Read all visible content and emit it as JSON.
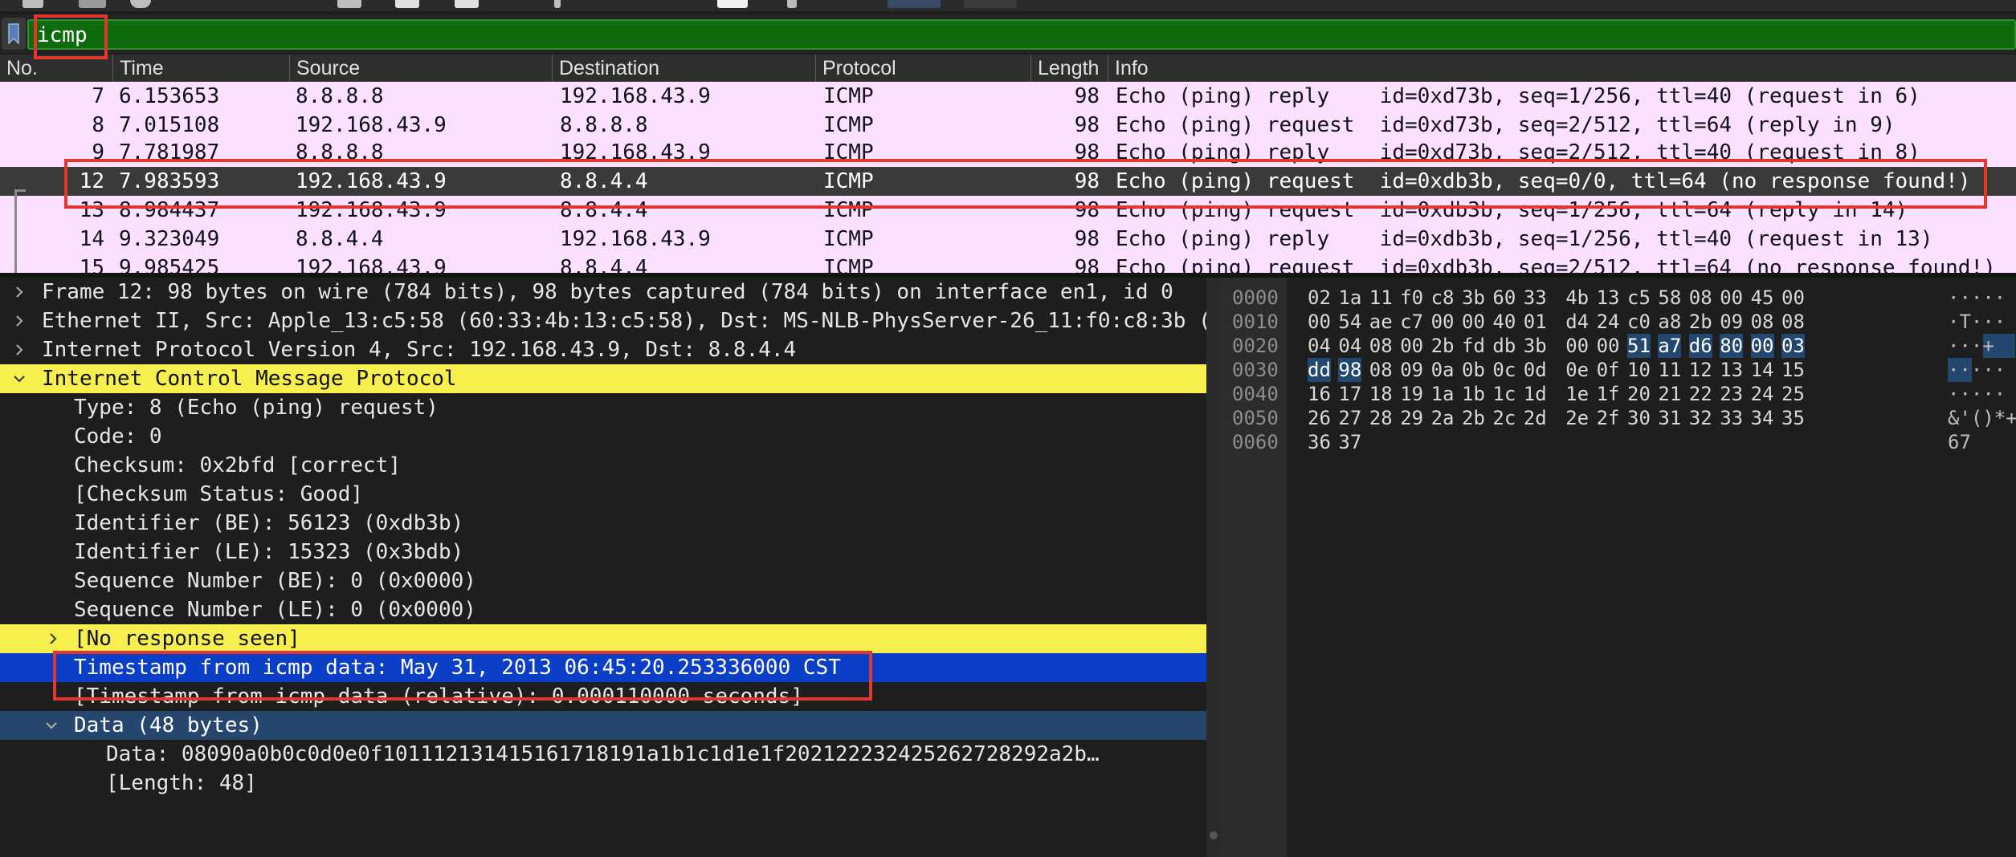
{
  "filter": {
    "value": "icmp"
  },
  "packet_list": {
    "columns": [
      "No.",
      "Time",
      "Source",
      "Destination",
      "Protocol",
      "Length",
      "Info"
    ],
    "rows": [
      {
        "no": "7",
        "time": "6.153653",
        "source": "8.8.8.8",
        "destination": "192.168.43.9",
        "protocol": "ICMP",
        "length": "98",
        "info": "Echo (ping) reply    id=0xd73b, seq=1/256, ttl=40 (request in 6)"
      },
      {
        "no": "8",
        "time": "7.015108",
        "source": "192.168.43.9",
        "destination": "8.8.8.8",
        "protocol": "ICMP",
        "length": "98",
        "info": "Echo (ping) request  id=0xd73b, seq=2/512, ttl=64 (reply in 9)"
      },
      {
        "no": "9",
        "time": "7.781987",
        "source": "8.8.8.8",
        "destination": "192.168.43.9",
        "protocol": "ICMP",
        "length": "98",
        "info": "Echo (ping) reply    id=0xd73b, seq=2/512, ttl=40 (request in 8)"
      },
      {
        "no": "12",
        "time": "7.983593",
        "source": "192.168.43.9",
        "destination": "8.8.4.4",
        "protocol": "ICMP",
        "length": "98",
        "info": "Echo (ping) request  id=0xdb3b, seq=0/0, ttl=64 (no response found!)"
      },
      {
        "no": "13",
        "time": "8.984437",
        "source": "192.168.43.9",
        "destination": "8.8.4.4",
        "protocol": "ICMP",
        "length": "98",
        "info": "Echo (ping) request  id=0xdb3b, seq=1/256, ttl=64 (reply in 14)"
      },
      {
        "no": "14",
        "time": "9.323049",
        "source": "8.8.4.4",
        "destination": "192.168.43.9",
        "protocol": "ICMP",
        "length": "98",
        "info": "Echo (ping) reply    id=0xdb3b, seq=1/256, ttl=40 (request in 13)"
      },
      {
        "no": "15",
        "time": "9.985425",
        "source": "192.168.43.9",
        "destination": "8.8.4.4",
        "protocol": "ICMP",
        "length": "98",
        "info": "Echo (ping) request  id=0xdb3b, seq=2/512, ttl=64 (no response found!)"
      }
    ]
  },
  "details": {
    "lines": [
      "Frame 12: 98 bytes on wire (784 bits), 98 bytes captured (784 bits) on interface en1, id 0",
      "Ethernet II, Src: Apple_13:c5:58 (60:33:4b:13:c5:58), Dst: MS-NLB-PhysServer-26_11:f0:c8:3b (",
      "Internet Protocol Version 4, Src: 192.168.43.9, Dst: 8.8.4.4",
      "Internet Control Message Protocol",
      "Type: 8 (Echo (ping) request)",
      "Code: 0",
      "Checksum: 0x2bfd [correct]",
      "[Checksum Status: Good]",
      "Identifier (BE): 56123 (0xdb3b)",
      "Identifier (LE): 15323 (0x3bdb)",
      "Sequence Number (BE): 0 (0x0000)",
      "Sequence Number (LE): 0 (0x0000)",
      "[No response seen]",
      "Timestamp from icmp data: May 31, 2013 06:45:20.253336000 CST",
      "[Timestamp from icmp data (relative): 0.000110000 seconds]",
      "Data (48 bytes)",
      "Data: 08090a0b0c0d0e0f101112131415161718191a1b1c1d1e1f202122232425262728292a2b…",
      "[Length: 48]"
    ]
  },
  "bytes": {
    "offsets": [
      "0000",
      "0010",
      "0020",
      "0030",
      "0040",
      "0050",
      "0060"
    ],
    "rows": [
      [
        "02",
        "1a",
        "11",
        "f0",
        "c8",
        "3b",
        "60",
        "33",
        "4b",
        "13",
        "c5",
        "58",
        "08",
        "00",
        "45",
        "00"
      ],
      [
        "00",
        "54",
        "ae",
        "c7",
        "00",
        "00",
        "40",
        "01",
        "d4",
        "24",
        "c0",
        "a8",
        "2b",
        "09",
        "08",
        "08"
      ],
      [
        "04",
        "04",
        "08",
        "00",
        "2b",
        "fd",
        "db",
        "3b",
        "00",
        "00",
        "51",
        "a7",
        "d6",
        "80",
        "00",
        "03"
      ],
      [
        "dd",
        "98",
        "08",
        "09",
        "0a",
        "0b",
        "0c",
        "0d",
        "0e",
        "0f",
        "10",
        "11",
        "12",
        "13",
        "14",
        "15"
      ],
      [
        "16",
        "17",
        "18",
        "19",
        "1a",
        "1b",
        "1c",
        "1d",
        "1e",
        "1f",
        "20",
        "21",
        "22",
        "23",
        "24",
        "25"
      ],
      [
        "26",
        "27",
        "28",
        "29",
        "2a",
        "2b",
        "2c",
        "2d",
        "2e",
        "2f",
        "30",
        "31",
        "32",
        "33",
        "34",
        "35"
      ],
      [
        "36",
        "37"
      ]
    ],
    "ascii": [
      "·····",
      "·T···",
      "···+",
      "·····",
      "·····",
      "&'()*+",
      "67"
    ]
  }
}
